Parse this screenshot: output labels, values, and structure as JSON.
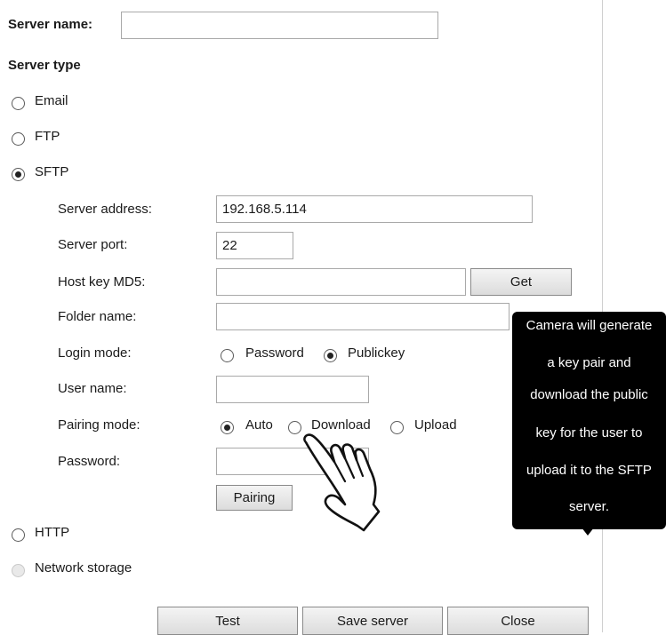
{
  "server_name": {
    "label": "Server name:",
    "value": ""
  },
  "server_type": {
    "heading": "Server type",
    "options": [
      {
        "label": "Email",
        "selected": false
      },
      {
        "label": "FTP",
        "selected": false
      },
      {
        "label": "SFTP",
        "selected": true
      },
      {
        "label": "HTTP",
        "selected": false
      },
      {
        "label": "Network storage",
        "selected": false,
        "disabled": true
      }
    ]
  },
  "sftp": {
    "server_address": {
      "label": "Server address:",
      "value": "192.168.5.114"
    },
    "server_port": {
      "label": "Server port:",
      "value": "22"
    },
    "host_key_md5": {
      "label": "Host key MD5:",
      "value": "",
      "button": "Get"
    },
    "folder_name": {
      "label": "Folder name:",
      "value": ""
    },
    "login_mode": {
      "label": "Login mode:",
      "options": [
        {
          "label": "Password",
          "selected": false
        },
        {
          "label": "Publickey",
          "selected": true
        }
      ]
    },
    "user_name": {
      "label": "User name:",
      "value": ""
    },
    "pairing_mode": {
      "label": "Pairing mode:",
      "options": [
        {
          "label": "Auto",
          "selected": true
        },
        {
          "label": "Download",
          "selected": false
        },
        {
          "label": "Upload",
          "selected": false
        }
      ]
    },
    "password": {
      "label": "Password:",
      "value": ""
    },
    "pairing_button": "Pairing"
  },
  "tooltip": {
    "lines": [
      "Camera will generate",
      "a key pair and",
      "download the public",
      "key for the user to",
      "upload it to the SFTP",
      "server."
    ]
  },
  "footer": {
    "test": "Test",
    "save": "Save server",
    "close": "Close"
  },
  "icons": {
    "pointer": "hand-pointer-icon"
  },
  "colors": {
    "tooltip_bg": "#000000",
    "tooltip_text": "#ffffff",
    "divider": "#cfcfcf"
  }
}
